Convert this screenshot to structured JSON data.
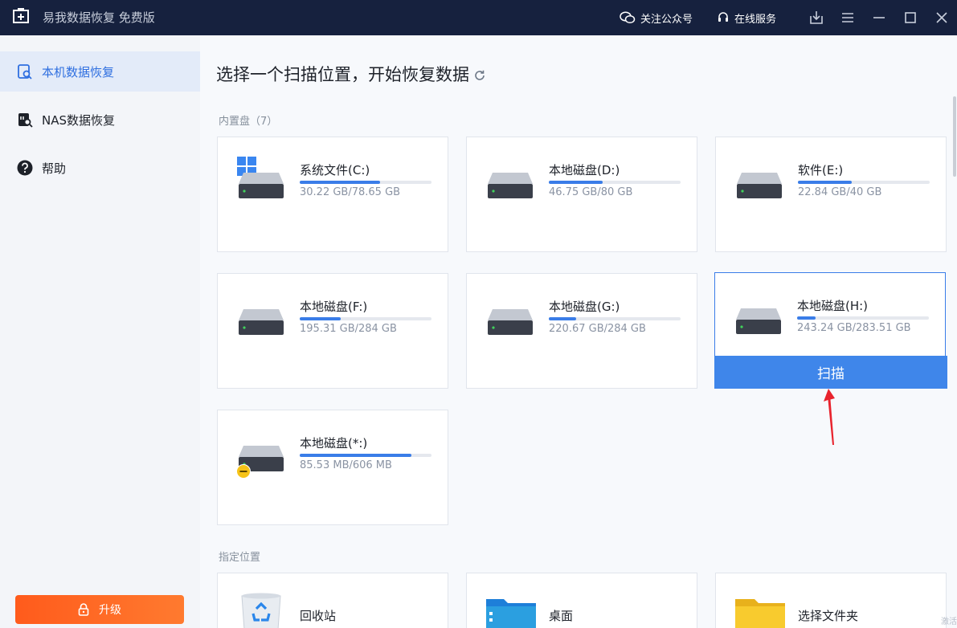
{
  "app": {
    "title": "易我数据恢复 免费版"
  },
  "titlebar": {
    "follow_label": "关注公众号",
    "service_label": "在线服务"
  },
  "sidebar": {
    "items": [
      {
        "label": "本机数据恢复",
        "icon": "local-recovery-icon",
        "active": true
      },
      {
        "label": "NAS数据恢复",
        "icon": "nas-recovery-icon",
        "active": false
      },
      {
        "label": "帮助",
        "icon": "help-icon",
        "active": false
      }
    ],
    "upgrade_label": "升级"
  },
  "main": {
    "heading": "选择一个扫描位置，开始恢复数据",
    "internal_label": "内置盘（7）",
    "drives": [
      {
        "name": "系统文件(C:)",
        "size": "30.22 GB/78.65 GB",
        "used_fraction": 0.61,
        "system": true
      },
      {
        "name": "本地磁盘(D:)",
        "size": "46.75 GB/80 GB",
        "used_fraction": 0.41
      },
      {
        "name": "软件(E:)",
        "size": "22.84 GB/40 GB",
        "used_fraction": 0.41
      },
      {
        "name": "本地磁盘(F:)",
        "size": "195.31 GB/284 GB",
        "used_fraction": 0.31
      },
      {
        "name": "本地磁盘(G:)",
        "size": "220.67 GB/284 GB",
        "used_fraction": 0.21
      },
      {
        "name": "本地磁盘(H:)",
        "size": "243.24 GB/283.51 GB",
        "used_fraction": 0.14,
        "selected": true
      },
      {
        "name": "本地磁盘(*:)",
        "size": "85.53 MB/606 MB",
        "used_fraction": 0.85,
        "warning": true
      }
    ],
    "scan_label": "扫描",
    "locations_label": "指定位置",
    "locations": [
      {
        "name": "回收站",
        "icon": "recycle-bin-icon"
      },
      {
        "name": "桌面",
        "icon": "desktop-folder-icon"
      },
      {
        "name": "选择文件夹",
        "icon": "folder-icon"
      }
    ]
  },
  "colors": {
    "accent": "#3f86ea",
    "titlebar": "#16213e",
    "upgrade": "#ff6a26",
    "arrow": "#e8232d"
  },
  "watermark": "激活"
}
